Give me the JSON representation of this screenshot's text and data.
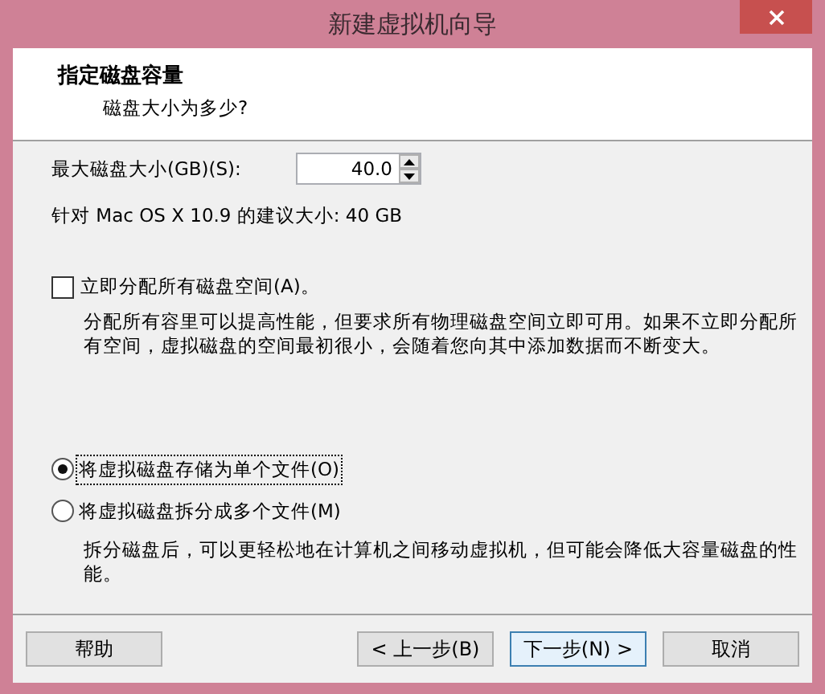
{
  "window": {
    "title": "新建虚拟机向导"
  },
  "header": {
    "title": "指定磁盘容量",
    "subtitle": "磁盘大小为多少?"
  },
  "size_field": {
    "label": "最大磁盘大小(GB)(S):",
    "value": "40.0"
  },
  "recommendation": "针对 Mac OS X 10.9 的建议大小: 40 GB",
  "allocate": {
    "label": "立即分配所有磁盘空间(A)。",
    "checked": false,
    "description": "分配所有容里可以提高性能，但要求所有物理磁盘空间立即可用。如果不立即分配所有空间，虚拟磁盘的空间最初很小，会随着您向其中添加数据而不断变大。"
  },
  "storage_options": [
    {
      "label": "将虚拟磁盘存储为单个文件(O)",
      "selected": true
    },
    {
      "label": "将虚拟磁盘拆分成多个文件(M)",
      "selected": false,
      "description": "拆分磁盘后，可以更轻松地在计算机之间移动虚拟机，但可能会降低大容量磁盘的性能。"
    }
  ],
  "buttons": [
    {
      "label": "帮助",
      "default": false
    },
    {
      "label": "< 上一步(B)",
      "default": false
    },
    {
      "label": "下一步(N) >",
      "default": true
    },
    {
      "label": "取消",
      "default": false
    }
  ]
}
